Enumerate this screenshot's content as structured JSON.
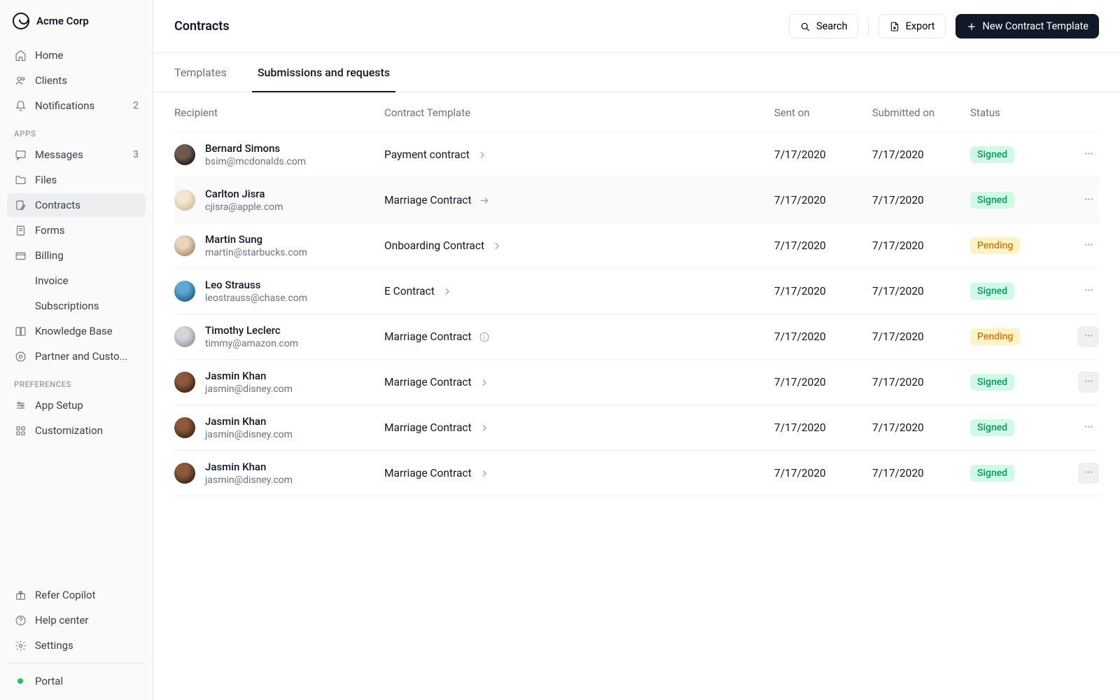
{
  "brand": {
    "name": "Acme Corp"
  },
  "nav": {
    "main": [
      {
        "id": "home",
        "label": "Home",
        "icon": "home"
      },
      {
        "id": "clients",
        "label": "Clients",
        "icon": "users"
      },
      {
        "id": "notifications",
        "label": "Notifications",
        "icon": "bell",
        "count": "2"
      }
    ],
    "apps_label": "APPS",
    "apps": [
      {
        "id": "messages",
        "label": "Messages",
        "icon": "chat",
        "count": "3"
      },
      {
        "id": "files",
        "label": "Files",
        "icon": "folder"
      },
      {
        "id": "contracts",
        "label": "Contracts",
        "icon": "doc-pen",
        "active": true
      },
      {
        "id": "forms",
        "label": "Forms",
        "icon": "doc"
      },
      {
        "id": "billing",
        "label": "Billing",
        "icon": "card"
      },
      {
        "id": "invoice",
        "label": "Invoice",
        "sub": true
      },
      {
        "id": "subscriptions",
        "label": "Subscriptions",
        "sub": true
      },
      {
        "id": "kb",
        "label": "Knowledge Base",
        "icon": "book"
      },
      {
        "id": "partner",
        "label": "Partner and Custo...",
        "icon": "gear-round"
      }
    ],
    "prefs_label": "PREFERENCES",
    "prefs": [
      {
        "id": "app-setup",
        "label": "App Setup",
        "icon": "sliders"
      },
      {
        "id": "customization",
        "label": "Customization",
        "icon": "grid"
      }
    ],
    "footer": [
      {
        "id": "refer",
        "label": "Refer Copilot",
        "icon": "gift"
      },
      {
        "id": "help",
        "label": "Help center",
        "icon": "help"
      },
      {
        "id": "settings",
        "label": "Settings",
        "icon": "gear"
      }
    ],
    "portal_label": "Portal"
  },
  "header": {
    "title": "Contracts",
    "search": "Search",
    "export": "Export",
    "new": "New Contract Template"
  },
  "tabs": [
    {
      "id": "templates",
      "label": "Templates"
    },
    {
      "id": "submissions",
      "label": "Submissions and requests",
      "active": true
    }
  ],
  "table": {
    "head": {
      "recipient": "Recipient",
      "template": "Contract Template",
      "sent": "Sent on",
      "submitted": "Submitted on",
      "status": "Status"
    },
    "rows": [
      {
        "name": "Bernard Simons",
        "email": "bsim@mcdonalds.com",
        "template": "Payment contract",
        "tIcon": "chev",
        "sent": "7/17/2020",
        "submitted": "7/17/2020",
        "status": "Signed",
        "avatar": "c1"
      },
      {
        "name": "Carlton Jisra",
        "email": "cjisra@apple.com",
        "template": "Marriage Contract",
        "tIcon": "arrow",
        "sent": "7/17/2020",
        "submitted": "7/17/2020",
        "status": "Signed",
        "avatar": "c2",
        "rowHover": true
      },
      {
        "name": "Martin Sung",
        "email": "martin@starbucks.com",
        "template": "Onboarding Contract",
        "tIcon": "chev",
        "sent": "7/17/2020",
        "submitted": "7/17/2020",
        "status": "Pending",
        "avatar": "c3"
      },
      {
        "name": "Leo Strauss",
        "email": "leostrauss@chase.com",
        "template": "E Contract",
        "tIcon": "chev",
        "sent": "7/17/2020",
        "submitted": "7/17/2020",
        "status": "Signed",
        "avatar": "c4"
      },
      {
        "name": "Timothy Leclerc",
        "email": "timmy@amazon.com",
        "template": "Marriage Contract",
        "tIcon": "info",
        "sent": "7/17/2020",
        "submitted": "7/17/2020",
        "status": "Pending",
        "avatar": "c5",
        "moreHover": true
      },
      {
        "name": "Jasmin Khan",
        "email": "jasmin@disney.com",
        "template": "Marriage Contract",
        "tIcon": "chev",
        "sent": "7/17/2020",
        "submitted": "7/17/2020",
        "status": "Signed",
        "avatar": "c6",
        "moreHover": true
      },
      {
        "name": "Jasmin Khan",
        "email": "jasmin@disney.com",
        "template": "Marriage Contract",
        "tIcon": "chev",
        "sent": "7/17/2020",
        "submitted": "7/17/2020",
        "status": "Signed",
        "avatar": "c6"
      },
      {
        "name": "Jasmin Khan",
        "email": "jasmin@disney.com",
        "template": "Marriage Contract",
        "tIcon": "chev",
        "sent": "7/17/2020",
        "submitted": "7/17/2020",
        "status": "Signed",
        "avatar": "c6",
        "moreHover": true
      }
    ]
  }
}
